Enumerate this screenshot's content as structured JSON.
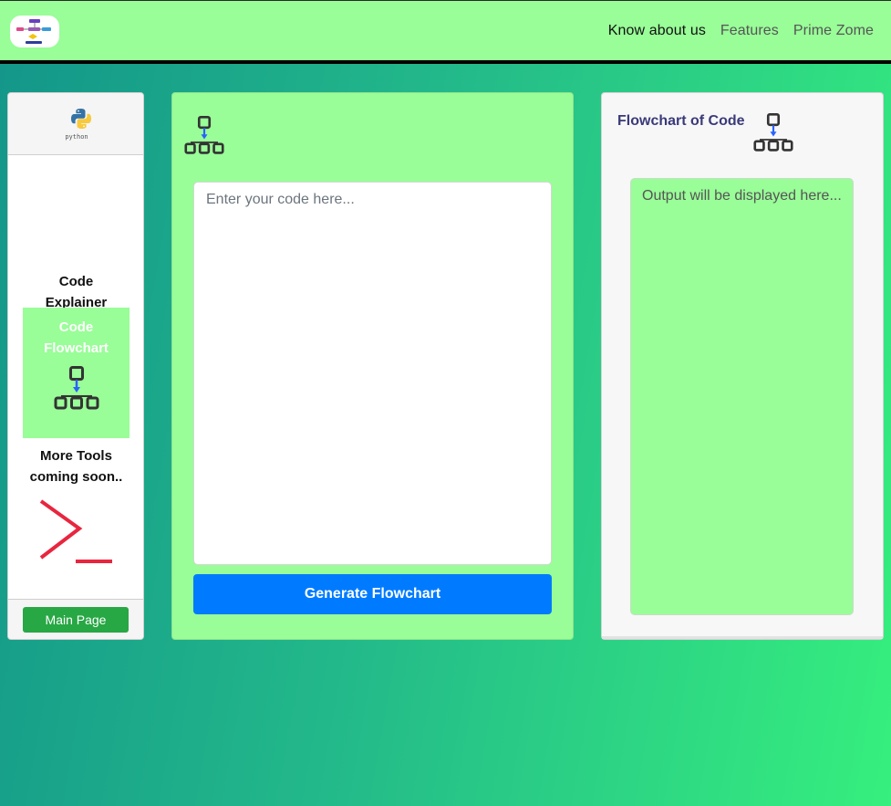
{
  "nav": {
    "logo_icon": "flowchart-logo-icon",
    "links": [
      "Know about us",
      "Features",
      "Prime Zome"
    ]
  },
  "sidebar": {
    "header_icon": "python-logo-icon",
    "header_text": "python",
    "tools": [
      {
        "label": "Code Explainer",
        "icon": "code-explainer-thumbnail"
      },
      {
        "label": "Code Flowchart",
        "icon": "flowchart-icon"
      },
      {
        "label": "More Tools coming soon..",
        "icon": "terminal-icon"
      }
    ],
    "main_page_label": "Main Page"
  },
  "editor": {
    "icon": "flowchart-icon",
    "placeholder": "Enter your code here...",
    "generate_label": "Generate Flowchart"
  },
  "output": {
    "title": "Flowchart of Code",
    "icon": "flowchart-icon",
    "placeholder": "Output will be displayed here..."
  },
  "colors": {
    "nav_bg": "#99fd98",
    "panel_green": "#99fd98",
    "primary_button": "#007bff",
    "success_button": "#28a745",
    "terminal_red": "#e8263f",
    "output_title": "#3a3a7a"
  }
}
